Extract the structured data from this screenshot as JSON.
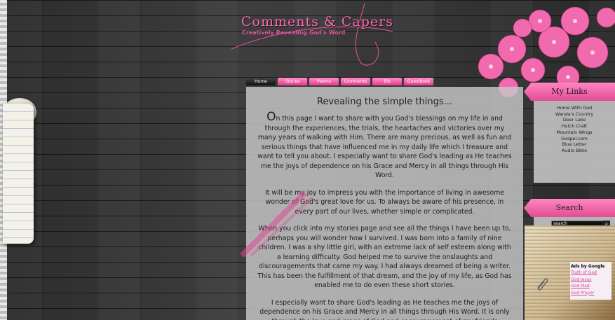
{
  "header": {
    "title": "Comments & Capers",
    "subtitle": "Creatively Revealing God's Word"
  },
  "nav": [
    "Home",
    "Stories",
    "Poems",
    "Comments",
    "Bio",
    "Guestbook"
  ],
  "main": {
    "heading": "Revealing the simple things...",
    "p1_cap": "O",
    "p1": "n this page I want to share with you God's blessings on my life in and through the experiences, the trials, the heartaches and victories over my many years of walking with Him. There are many precious, as well as fun and serious things that have influenced me in my daily life which I treasure and want to tell you about. I especially want to share God's leading as He teaches me the joys of dependence on his Grace and Mercy in all things through His Word.",
    "p2": "It will be my joy to impress you with the importance of living in awesome wonder of God's great love for us. To always be aware of his presence, in every part of our lives, whether simple or complicated.",
    "p3": "When you click into my stories page and see all the things I have been up to, perhaps you will wonder how I survived. I was born into a family of nine children. I was a shy little girl, with an extreme lack of self esteem along with a learning difficulty. God helped me to survive the onslaughts and discouragements that came my way. I had always dreamed of being a writer. This has been the fulfillment of that dream, and the joy of my life, as God has enabled me to do even these short stories.",
    "p4": "I especially want to share God's leading as He teaches me the joys of dependence on his Grace and Mercy in all things through His Word. It is only through the love and grace of God and encouragement of my friends"
  },
  "sidebar": {
    "links_title": "My Links",
    "links": [
      "Home With God",
      "Wanda's Country",
      "Deer Lake",
      "Hutch Craft",
      "Mountain Wings",
      "Gospel.com",
      "Blue Letter",
      "Audio Bible"
    ],
    "search_title": "Search",
    "search_value": "search",
    "search_button": "⌕",
    "ads_title": "Ads by Google",
    "ads": [
      "Truth of God",
      "God Jesus",
      "God Mad",
      "God Prayer"
    ]
  }
}
